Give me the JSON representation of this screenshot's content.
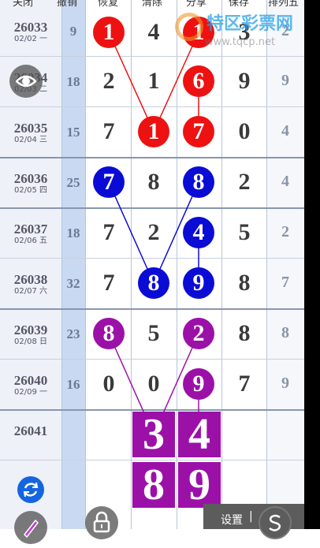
{
  "header": {
    "labels": [
      "关闭",
      "撤销",
      "恢复",
      "清除",
      "分享",
      "保存",
      "排列五"
    ]
  },
  "rows": [
    {
      "issue": "26033",
      "date": "02/02 一",
      "sum": "9",
      "right": "",
      "n1": "1",
      "n2": "4",
      "n3": "1",
      "n4": "3",
      "n5": "2"
    },
    {
      "issue": "26034",
      "date": "02/03 二",
      "sum": "18",
      "right": "9",
      "n1": "2",
      "n2": "1",
      "n3": "6",
      "n4": "9",
      "n5": ""
    },
    {
      "issue": "26035",
      "date": "02/04 三",
      "sum": "15",
      "right": "4",
      "n1": "7",
      "n2": "1",
      "n3": "7",
      "n4": "0",
      "n5": ""
    },
    {
      "issue": "26036",
      "date": "02/05 四",
      "sum": "25",
      "right": "4",
      "n1": "7",
      "n2": "8",
      "n3": "8",
      "n4": "2",
      "n5": ""
    },
    {
      "issue": "26037",
      "date": "02/06 五",
      "sum": "18",
      "right": "2",
      "n1": "7",
      "n2": "2",
      "n3": "4",
      "n4": "5",
      "n5": ""
    },
    {
      "issue": "26038",
      "date": "02/07 六",
      "sum": "32",
      "right": "7",
      "n1": "7",
      "n2": "8",
      "n3": "9",
      "n4": "8",
      "n5": ""
    },
    {
      "issue": "26039",
      "date": "02/08 日",
      "sum": "23",
      "right": "8",
      "n1": "8",
      "n2": "5",
      "n3": "2",
      "n4": "8",
      "n5": ""
    },
    {
      "issue": "26040",
      "date": "02/09 一",
      "sum": "16",
      "right": "9",
      "n1": "0",
      "n2": "0",
      "n3": "9",
      "n4": "7",
      "n5": ""
    }
  ],
  "next_issue": "26041",
  "prediction": [
    "3",
    "4",
    "8",
    "9"
  ],
  "watermark": {
    "title": "特区彩票网",
    "url": "www.tqcp.net"
  },
  "bottom_bar": {
    "settings_label": "设置",
    "icons": [
      "eye-icon",
      "refresh-icon",
      "pen-icon",
      "lock-icon",
      "s-icon"
    ]
  },
  "colors": {
    "red": "#ee1111",
    "blue": "#0b0bd6",
    "purple": "#9b11a8"
  }
}
